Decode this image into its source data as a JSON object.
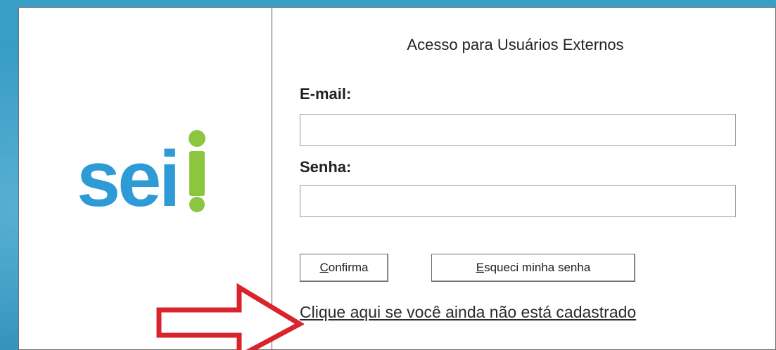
{
  "logo": {
    "text_main": "sei",
    "text_mark": "!",
    "brand_blue": "#2e9bd6",
    "brand_green": "#8cc63f"
  },
  "form": {
    "title": "Acesso para Usuários Externos",
    "email_label": "E-mail:",
    "email_value": "",
    "password_label": "Senha:",
    "password_value": "",
    "confirm_button": {
      "accel": "C",
      "rest": "onfirma"
    },
    "forgot_button": {
      "accel": "E",
      "rest": "squeci minha senha"
    },
    "signup_link": "Clique aqui se você ainda não está cadastrado"
  },
  "annotation": {
    "arrow_icon": "right-arrow-icon",
    "arrow_color": "#d9232d"
  }
}
